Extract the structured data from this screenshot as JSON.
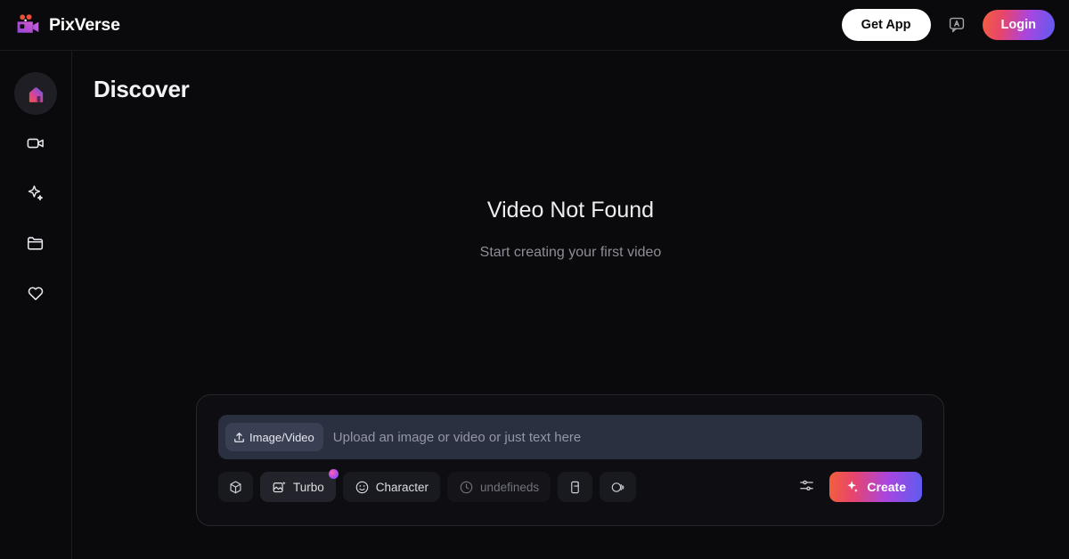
{
  "header": {
    "brand_name": "PixVerse",
    "brand_logo_icon": "video-camera-logo-icon",
    "get_app_label": "Get App",
    "language_icon": "language-translate-icon",
    "login_label": "Login",
    "login_gradient": [
      "#f2603f",
      "#e8456b",
      "#a945e0",
      "#5d5cf0"
    ]
  },
  "sidebar": {
    "items": [
      {
        "name": "home",
        "icon": "home-icon",
        "active": true
      },
      {
        "name": "video",
        "icon": "video-camera-icon",
        "active": false
      },
      {
        "name": "effects",
        "icon": "sparkle-icon",
        "active": false
      },
      {
        "name": "assets",
        "icon": "folder-icon",
        "active": false
      },
      {
        "name": "favorites",
        "icon": "heart-icon",
        "active": false
      }
    ]
  },
  "main": {
    "page_title": "Discover",
    "empty_state": {
      "title": "Video Not Found",
      "subtitle": "Start creating your first video"
    }
  },
  "prompt_panel": {
    "upload_chip": {
      "label": "Image/Video",
      "icon": "upload-icon"
    },
    "input_placeholder": "Upload an image or video or just text here",
    "input_value": "",
    "toolbar": [
      {
        "name": "model",
        "label": "",
        "icon": "cube-icon",
        "style": "icon-only",
        "badge": false
      },
      {
        "name": "turbo",
        "label": "Turbo",
        "icon": "image-sparkle-icon",
        "style": "raised",
        "badge": true
      },
      {
        "name": "character",
        "label": "Character",
        "icon": "smiley-icon",
        "style": "normal",
        "badge": false
      },
      {
        "name": "duration",
        "label": "undefineds",
        "icon": "clock-icon",
        "style": "dim",
        "badge": false
      },
      {
        "name": "ratio",
        "label": "",
        "icon": "aspect-ratio-icon",
        "style": "icon-only",
        "badge": false
      },
      {
        "name": "quality",
        "label": "",
        "icon": "resolution-icon",
        "style": "icon-only",
        "badge": false
      }
    ],
    "settings_icon": "sliders-icon",
    "create": {
      "label": "Create",
      "icon": "sparkle-icon",
      "gradient": [
        "#f4603c",
        "#e8456b",
        "#a945e0",
        "#5d5cf0"
      ]
    }
  }
}
